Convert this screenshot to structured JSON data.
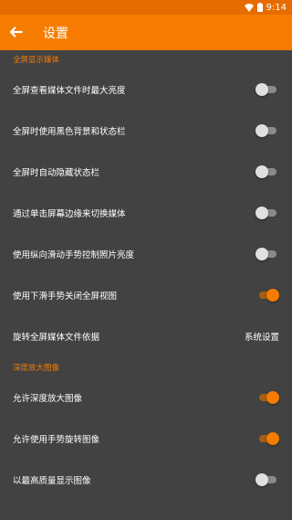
{
  "status_bar": {
    "time": "9:14",
    "wifi_icon": "wifi-icon",
    "battery_icon": "battery-icon"
  },
  "app_bar": {
    "title": "设置",
    "back_icon": "arrow-left-icon"
  },
  "colors": {
    "accent": "#f57c00",
    "status_bar": "#e66c00",
    "background": "#424242"
  },
  "sections": [
    {
      "header": "全屏显示媒体",
      "items": [
        {
          "label": "全屏查看媒体文件时最大亮度",
          "type": "switch",
          "checked": false
        },
        {
          "label": "全屏时使用黑色背景和状态栏",
          "type": "switch",
          "checked": false
        },
        {
          "label": "全屏时自动隐藏状态栏",
          "type": "switch",
          "checked": false
        },
        {
          "label": "通过单击屏幕边缘来切换媒体",
          "type": "switch",
          "checked": false
        },
        {
          "label": "使用纵向滑动手势控制照片亮度",
          "type": "switch",
          "checked": false
        },
        {
          "label": "使用下滑手势关闭全屏视图",
          "type": "switch",
          "checked": true
        },
        {
          "label": "旋转全屏媒体文件依据",
          "type": "value",
          "value": "系统设置"
        }
      ]
    },
    {
      "header": "深度放大图像",
      "items": [
        {
          "label": "允许深度放大图像",
          "type": "switch",
          "checked": true
        },
        {
          "label": "允许使用手势旋转图像",
          "type": "switch",
          "checked": true
        },
        {
          "label": "以最高质量显示图像",
          "type": "switch",
          "checked": false
        }
      ]
    }
  ]
}
